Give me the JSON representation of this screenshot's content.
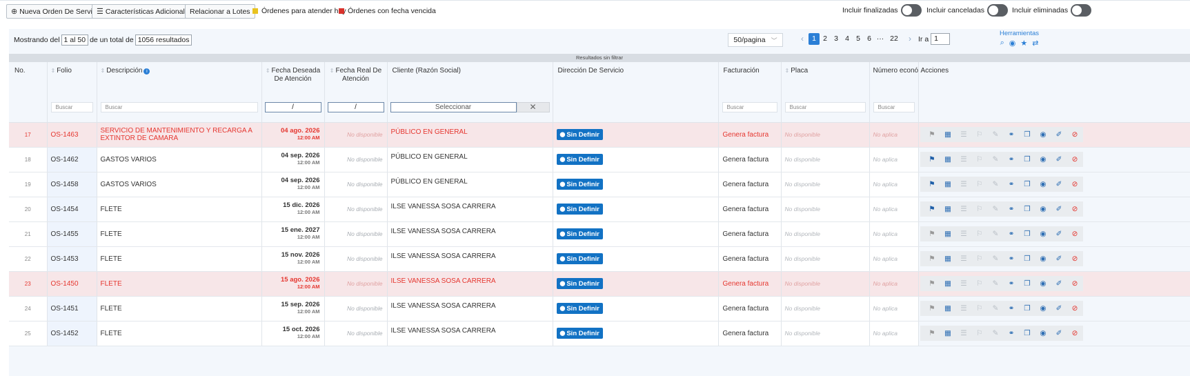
{
  "toolbar": {
    "new_order": "Nueva Orden De Servicio",
    "features": "Características Adicionales",
    "relate_lots": "Relacionar a Lotes",
    "legend_today": "Órdenes para atender hoy",
    "legend_today_color": "#e8c21f",
    "legend_overdue": "Órdenes con fecha vencida",
    "legend_overdue_color": "#d9322b",
    "include_finished": "Incluir finalizadas",
    "include_cancelled": "Incluir canceladas",
    "include_deleted": "Incluir eliminadas"
  },
  "summary": {
    "showing_prefix": "Mostrando del",
    "range": "1 al 50",
    "of_total": "de un total de",
    "total": "1056 resultados"
  },
  "pagination": {
    "per_page": "50/pagina",
    "pages": [
      "1",
      "2",
      "3",
      "4",
      "5",
      "6",
      "···",
      "22"
    ],
    "active_page": "1",
    "goto_label": "Ir a",
    "goto_value": "1"
  },
  "tools": {
    "title": "Herramientas"
  },
  "filter_banner": "Resultados sin filtrar",
  "columns": {
    "no": "No.",
    "folio": "Folio",
    "descripcion": "Descripción",
    "fecha_deseada": "Fecha Deseada De Atención",
    "fecha_real": "Fecha Real De Atención",
    "cliente": "Cliente (Razón Social)",
    "direccion": "Dirección De Servicio",
    "facturacion": "Facturación",
    "placa": "Placa",
    "numero": "Número econón",
    "acciones": "Acciones"
  },
  "filters": {
    "folio_placeholder": "Buscar",
    "descripcion_placeholder": "Buscar",
    "fecha_deseada": "/",
    "fecha_real": "/",
    "cliente_select": "Seleccionar",
    "facturacion_placeholder": "Buscar",
    "placa_placeholder": "Buscar",
    "numero_placeholder": "Buscar"
  },
  "rows": [
    {
      "no": "17",
      "folio": "OS-1463",
      "descripcion": "SERVICIO DE MANTENIMIENTO Y RECARGA A EXTINTOR DE CAMARA",
      "fecha": "04 ago. 2026",
      "hora": "12:00 AM",
      "fecha_real": "No disponible",
      "cliente": "PÚBLICO EN GENERAL",
      "direccion": "Sin Definir",
      "facturacion": "Genera factura",
      "placa": "No disponible",
      "numero": "No aplica",
      "overdue": true
    },
    {
      "no": "18",
      "folio": "OS-1462",
      "descripcion": "GASTOS VARIOS",
      "fecha": "04 sep. 2026",
      "hora": "12:00 AM",
      "fecha_real": "No disponible",
      "cliente": "PÚBLICO EN GENERAL",
      "direccion": "Sin Definir",
      "facturacion": "Genera factura",
      "placa": "No disponible",
      "numero": "No aplica",
      "overdue": false
    },
    {
      "no": "19",
      "folio": "OS-1458",
      "descripcion": "GASTOS VARIOS",
      "fecha": "04 sep. 2026",
      "hora": "12:00 AM",
      "fecha_real": "No disponible",
      "cliente": "PÚBLICO EN GENERAL",
      "direccion": "Sin Definir",
      "facturacion": "Genera factura",
      "placa": "No disponible",
      "numero": "No aplica",
      "overdue": false
    },
    {
      "no": "20",
      "folio": "OS-1454",
      "descripcion": "FLETE",
      "fecha": "15 dic. 2026",
      "hora": "12:00 AM",
      "fecha_real": "No disponible",
      "cliente": "ILSE VANESSA SOSA CARRERA",
      "direccion": "Sin Definir",
      "facturacion": "Genera factura",
      "placa": "No disponible",
      "numero": "No aplica",
      "overdue": false
    },
    {
      "no": "21",
      "folio": "OS-1455",
      "descripcion": "FLETE",
      "fecha": "15 ene. 2027",
      "hora": "12:00 AM",
      "fecha_real": "No disponible",
      "cliente": "ILSE VANESSA SOSA CARRERA",
      "direccion": "Sin Definir",
      "facturacion": "Genera factura",
      "placa": "No disponible",
      "numero": "No aplica",
      "overdue": false
    },
    {
      "no": "22",
      "folio": "OS-1453",
      "descripcion": "FLETE",
      "fecha": "15 nov. 2026",
      "hora": "12:00 AM",
      "fecha_real": "No disponible",
      "cliente": "ILSE VANESSA SOSA CARRERA",
      "direccion": "Sin Definir",
      "facturacion": "Genera factura",
      "placa": "No disponible",
      "numero": "No aplica",
      "overdue": false
    },
    {
      "no": "23",
      "folio": "OS-1450",
      "descripcion": "FLETE",
      "fecha": "15 ago. 2026",
      "hora": "12:00 AM",
      "fecha_real": "No disponible",
      "cliente": "ILSE VANESSA SOSA CARRERA",
      "direccion": "Sin Definir",
      "facturacion": "Genera factura",
      "placa": "No disponible",
      "numero": "No aplica",
      "overdue": true
    },
    {
      "no": "24",
      "folio": "OS-1451",
      "descripcion": "FLETE",
      "fecha": "15 sep. 2026",
      "hora": "12:00 AM",
      "fecha_real": "No disponible",
      "cliente": "ILSE VANESSA SOSA CARRERA",
      "direccion": "Sin Definir",
      "facturacion": "Genera factura",
      "placa": "No disponible",
      "numero": "No aplica",
      "overdue": false
    },
    {
      "no": "25",
      "folio": "OS-1452",
      "descripcion": "FLETE",
      "fecha": "15 oct. 2026",
      "hora": "12:00 AM",
      "fecha_real": "No disponible",
      "cliente": "ILSE VANESSA SOSA CARRERA",
      "direccion": "Sin Definir",
      "facturacion": "Genera factura",
      "placa": "No disponible",
      "numero": "No aplica",
      "overdue": false
    }
  ]
}
